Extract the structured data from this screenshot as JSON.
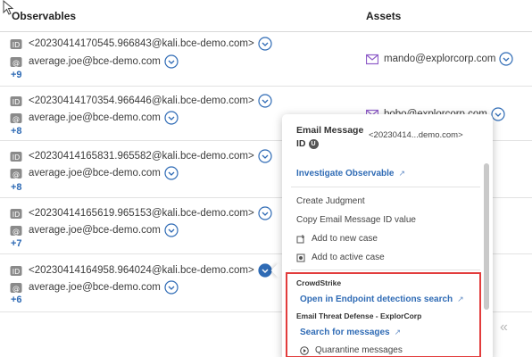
{
  "table": {
    "headers": {
      "observables": "Observables",
      "assets": "Assets"
    },
    "rows": [
      {
        "message_id": "<20230414170545.966843@kali.bce-demo.com>",
        "email": "average.joe@bce-demo.com",
        "more": "+9",
        "asset": "mando@explorcorp.com"
      },
      {
        "message_id": "<20230414170354.966446@kali.bce-demo.com>",
        "email": "average.joe@bce-demo.com",
        "more": "+8",
        "asset": "bobo@explorcorp.com"
      },
      {
        "message_id": "<20230414165831.965582@kali.bce-demo.com>",
        "email": "average.joe@bce-demo.com",
        "more": "+8",
        "asset": ""
      },
      {
        "message_id": "<20230414165619.965153@kali.bce-demo.com>",
        "email": "average.joe@bce-demo.com",
        "more": "+7",
        "asset": ""
      },
      {
        "message_id": "<20230414164958.964024@kali.bce-demo.com>",
        "email": "average.joe@bce-demo.com",
        "more": "+6",
        "asset": ""
      }
    ]
  },
  "pagination": {
    "first": "«"
  },
  "popover": {
    "title_line1": "Email Message",
    "title_line2": "ID",
    "badge": "U",
    "value": "<20230414...demo.com>",
    "investigate": "Investigate Observable",
    "create_judgment": "Create Judgment",
    "copy_value": "Copy Email Message ID value",
    "add_new_case": "Add to new case",
    "add_active_case": "Add to active case",
    "crowdstrike_group": "CrowdStrike",
    "crowdstrike_action": "Open in Endpoint detections search",
    "etd_group": "Email Threat Defense - ExplorCorp",
    "etd_search": "Search for messages",
    "etd_quarantine": "Quarantine messages"
  },
  "colors": {
    "accent": "#2f6bb5",
    "highlight": "#e23c3c",
    "email_icon": "#8e5cc8"
  }
}
